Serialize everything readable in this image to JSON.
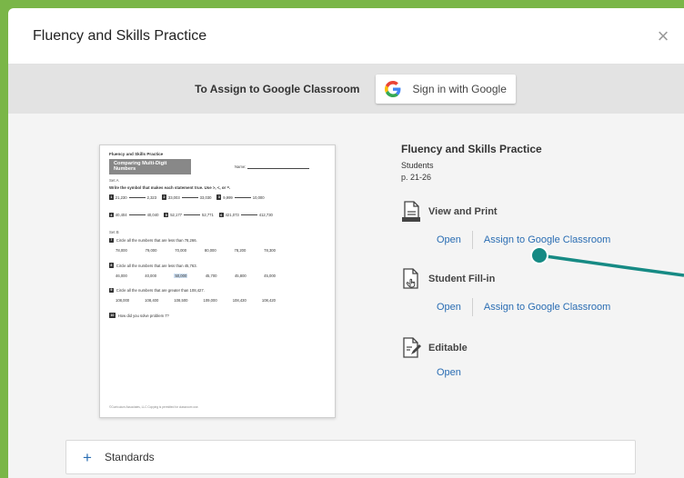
{
  "modal": {
    "title": "Fluency and Skills Practice",
    "close_glyph": "×"
  },
  "google_bar": {
    "label": "To Assign to Google Classroom",
    "sign_in_label": "Sign in with Google"
  },
  "resource": {
    "title": "Fluency and Skills Practice",
    "audience": "Students",
    "pages": "p. 21-26"
  },
  "sections": [
    {
      "title": "View and Print",
      "icon": "print-document-icon",
      "links": [
        "Open",
        "Assign to Google Classroom"
      ]
    },
    {
      "title": "Student Fill-in",
      "icon": "fill-in-document-icon",
      "links": [
        "Open",
        "Assign to Google Classroom"
      ]
    },
    {
      "title": "Editable",
      "icon": "edit-document-icon",
      "links": [
        "Open"
      ]
    }
  ],
  "standards": {
    "label": "Standards",
    "expand_glyph": "+"
  },
  "worksheet": {
    "header": "Fluency and Skills Practice",
    "banner": "Comparing Multi-Digit Numbers",
    "name_label": "Name:",
    "set_a": "Set A",
    "instruction": "Write the symbol that makes each statement true. Use >, <, or =.",
    "row1": [
      {
        "n": "1",
        "a": "21,230",
        "b": "2,323"
      },
      {
        "n": "2",
        "a": "33,003",
        "b": "33,030"
      },
      {
        "n": "3",
        "a": "9,999",
        "b": "10,000"
      }
    ],
    "row2": [
      {
        "n": "4",
        "a": "40,404",
        "b": "40,040"
      },
      {
        "n": "5",
        "a": "52,177",
        "b": "52,771"
      },
      {
        "n": "6",
        "a": "421,073",
        "b": "412,730"
      }
    ],
    "set_b": "Set B",
    "q7": {
      "n": "7",
      "text": "Circle all the numbers that are less than 78,266.",
      "vals": [
        "78,000",
        "79,000",
        "70,000",
        "80,000",
        "78,200",
        "78,300"
      ]
    },
    "q8": {
      "n": "8",
      "text": "Circle all the numbers that are less than 45,763.",
      "vals": [
        "46,000",
        "40,000",
        "50,000",
        "45,700",
        "45,800",
        "45,000"
      ]
    },
    "q9": {
      "n": "9",
      "text": "Circle all the numbers that are greater than 108,427.",
      "vals": [
        "108,000",
        "108,400",
        "108,500",
        "109,000",
        "108,430",
        "108,420"
      ]
    },
    "q10": {
      "n": "10",
      "text": "How did you solve problem 7?"
    },
    "footer": "©Curriculum Associates, LLC   Copying is permitted for classroom use."
  },
  "colors": {
    "background_green": "#7ab648",
    "link_blue": "#2a6db3",
    "pointer_teal": "#168a84"
  }
}
